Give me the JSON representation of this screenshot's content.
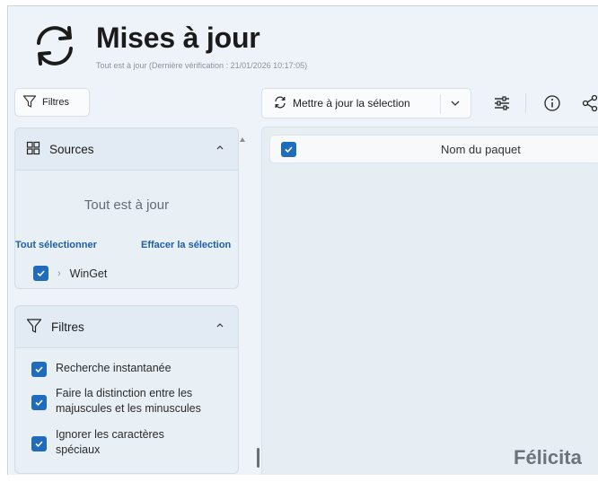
{
  "header": {
    "title": "Mises à jour",
    "subtitle": "Tout est à jour (Dernière vérification : 21/01/2026 10:17:05)"
  },
  "filters_toggle": {
    "label": "Filtres"
  },
  "toolbar": {
    "update_selection_label": "Mettre à jour la sélection",
    "icons": [
      "refresh-icon",
      "chevron-down-icon",
      "sliders-icon",
      "info-icon",
      "share-icon"
    ]
  },
  "sources": {
    "title": "Sources",
    "status": "Tout est à jour",
    "select_all": "Tout sélectionner",
    "clear_selection": "Effacer la sélection",
    "items": [
      {
        "label": "WinGet",
        "checked": true
      }
    ]
  },
  "filters": {
    "title": "Filtres",
    "options": [
      {
        "label": "Recherche instantanée",
        "checked": true
      },
      {
        "label": "Faire la distinction entre les majuscules et les minuscules",
        "checked": true
      },
      {
        "label": "Ignorer les caractères spéciaux",
        "checked": true
      }
    ]
  },
  "package_list": {
    "column_name": "Nom du paquet",
    "empty_message": "Félicita"
  },
  "colors": {
    "accent": "#1f6bbd",
    "link": "#1e5fa8",
    "background": "#edf3f8",
    "card": "#e2ebf3"
  }
}
